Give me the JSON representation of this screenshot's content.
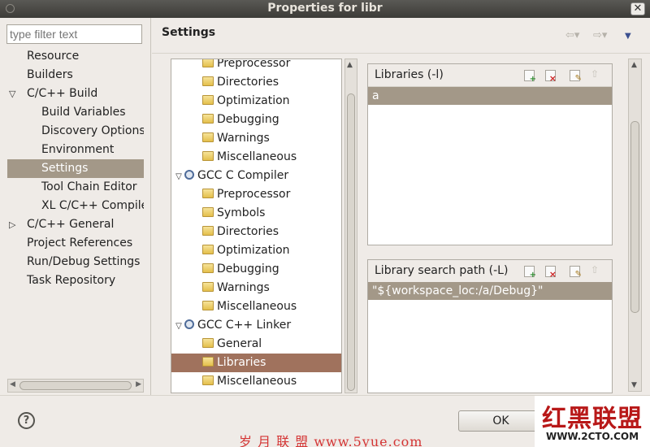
{
  "window": {
    "title": "Properties for libr"
  },
  "filter": {
    "placeholder": "type filter text"
  },
  "nav": {
    "items": [
      {
        "label": "Resource"
      },
      {
        "label": "Builders"
      },
      {
        "label": "C/C++ Build",
        "arrow": "▽"
      },
      {
        "label": "Build Variables"
      },
      {
        "label": "Discovery Options"
      },
      {
        "label": "Environment"
      },
      {
        "label": "Settings"
      },
      {
        "label": "Tool Chain Editor"
      },
      {
        "label": "XL C/C++ Compiler"
      },
      {
        "label": "C/C++ General",
        "arrow": "▷"
      },
      {
        "label": "Project References"
      },
      {
        "label": "Run/Debug Settings"
      },
      {
        "label": "Task Repository"
      }
    ]
  },
  "header": {
    "title": "Settings",
    "back_glyph": "⇦▾",
    "fwd_glyph": "⇨▾",
    "menu_glyph": "▼"
  },
  "tree": {
    "items": [
      {
        "label": "Preprocessor",
        "icon": "folder-options-icon"
      },
      {
        "label": "Directories",
        "icon": "folder-options-icon"
      },
      {
        "label": "Optimization",
        "icon": "folder-options-icon"
      },
      {
        "label": "Debugging",
        "icon": "folder-options-icon"
      },
      {
        "label": "Warnings",
        "icon": "folder-options-icon"
      },
      {
        "label": "Miscellaneous",
        "icon": "folder-options-icon"
      },
      {
        "label": "GCC C Compiler",
        "icon": "tool-gear-icon",
        "expanded": true
      },
      {
        "label": "Preprocessor",
        "icon": "folder-options-icon"
      },
      {
        "label": "Symbols",
        "icon": "folder-options-icon"
      },
      {
        "label": "Directories",
        "icon": "folder-options-icon"
      },
      {
        "label": "Optimization",
        "icon": "folder-options-icon"
      },
      {
        "label": "Debugging",
        "icon": "folder-options-icon"
      },
      {
        "label": "Warnings",
        "icon": "folder-options-icon"
      },
      {
        "label": "Miscellaneous",
        "icon": "folder-options-icon"
      },
      {
        "label": "GCC C++ Linker",
        "icon": "tool-gear-icon",
        "expanded": true
      },
      {
        "label": "General",
        "icon": "folder-options-icon"
      },
      {
        "label": "Libraries",
        "icon": "folder-options-icon"
      },
      {
        "label": "Miscellaneous",
        "icon": "folder-options-icon"
      }
    ]
  },
  "libraries": {
    "title": "Libraries (-l)",
    "rows": [
      "a"
    ]
  },
  "search_path": {
    "title": "Library search path (-L)",
    "rows": [
      "\"${workspace_loc:/a/Debug}\""
    ]
  },
  "buttons": {
    "ok": "OK",
    "help": "?"
  },
  "watermark": {
    "left": "岁 月 联 盟  www.5yue.com",
    "right_big": "红黑联盟",
    "right_url": "WWW.2CTO.COM"
  },
  "colors": {
    "selection": "#a39888",
    "tree_selection": "#a0725d",
    "titlebar": "#3c3b37"
  }
}
